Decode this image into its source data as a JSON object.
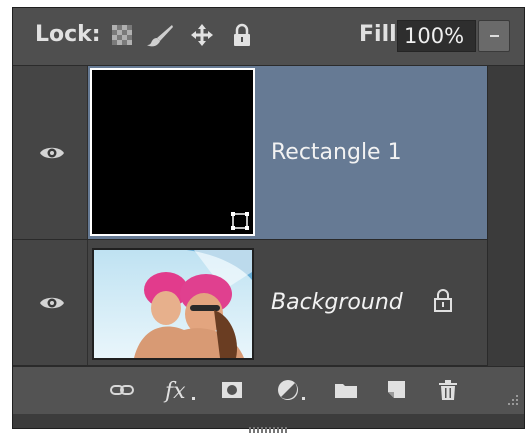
{
  "lock_bar": {
    "lock_label": "Lock:",
    "fill_label": "Fill:",
    "fill_value": "100%",
    "icons": [
      "lock-transparent-pixels-icon",
      "lock-image-pixels-icon",
      "lock-position-icon",
      "lock-all-icon"
    ]
  },
  "layers": [
    {
      "name": "Rectangle 1",
      "selected": true,
      "visible": true,
      "thumbnail": "black-shape-thumbnail",
      "badge": "vector-mask-icon"
    },
    {
      "name": "Background",
      "selected": false,
      "visible": true,
      "thumbnail": "photo-thumbnail",
      "locked": true
    }
  ],
  "footer_icons": [
    "link-layers-icon",
    "fx-icon",
    "add-mask-icon",
    "adjustment-layer-icon",
    "folder-icon",
    "new-layer-icon",
    "trash-icon"
  ],
  "colors": {
    "panel_bg": "#454545",
    "selected_row": "#667a94",
    "toolbar": "#535353"
  }
}
